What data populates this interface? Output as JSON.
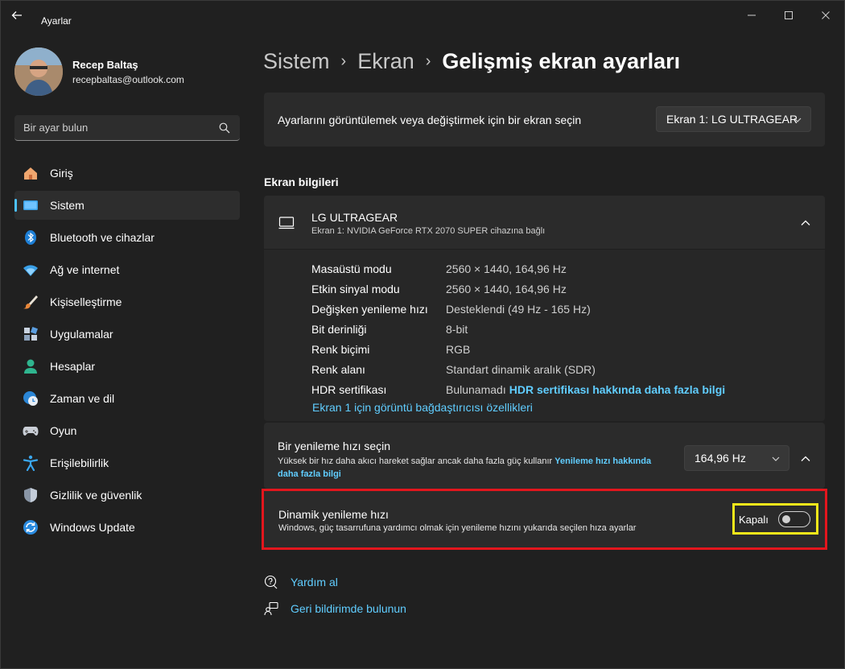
{
  "app": {
    "title": "Ayarlar"
  },
  "profile": {
    "name": "Recep Baltaş",
    "email": "recepbaltas@outlook.com"
  },
  "search": {
    "placeholder": "Bir ayar bulun"
  },
  "nav": {
    "items": [
      {
        "label": "Giriş",
        "icon": "home-icon"
      },
      {
        "label": "Sistem",
        "icon": "system-icon",
        "active": true
      },
      {
        "label": "Bluetooth ve cihazlar",
        "icon": "bluetooth-icon"
      },
      {
        "label": "Ağ ve internet",
        "icon": "wifi-icon"
      },
      {
        "label": "Kişiselleştirme",
        "icon": "brush-icon"
      },
      {
        "label": "Uygulamalar",
        "icon": "apps-icon"
      },
      {
        "label": "Hesaplar",
        "icon": "account-icon"
      },
      {
        "label": "Zaman ve dil",
        "icon": "clock-globe-icon"
      },
      {
        "label": "Oyun",
        "icon": "gamepad-icon"
      },
      {
        "label": "Erişilebilirlik",
        "icon": "accessibility-icon"
      },
      {
        "label": "Gizlilik ve güvenlik",
        "icon": "shield-icon"
      },
      {
        "label": "Windows Update",
        "icon": "update-icon"
      }
    ]
  },
  "breadcrumb": {
    "level1": "Sistem",
    "level2": "Ekran",
    "current": "Gelişmiş ekran ayarları",
    "separator": "›"
  },
  "display_select": {
    "label": "Ayarlarını görüntülemek veya değiştirmek için bir ekran seçin",
    "selected": "Ekran 1: LG ULTRAGEAR"
  },
  "info": {
    "section_title": "Ekran bilgileri",
    "monitor_name": "LG ULTRAGEAR",
    "monitor_sub": "Ekran 1: NVIDIA GeForce RTX 2070 SUPER cihazına bağlı",
    "rows": [
      {
        "key": "Masaüstü modu",
        "value": "2560 × 1440, 164,96 Hz"
      },
      {
        "key": "Etkin sinyal modu",
        "value": "2560 × 1440, 164,96 Hz"
      },
      {
        "key": "Değişken yenileme hızı",
        "value": "Desteklendi (49 Hz - 165 Hz)"
      },
      {
        "key": "Bit derinliği",
        "value": "8-bit"
      },
      {
        "key": "Renk biçimi",
        "value": "RGB"
      },
      {
        "key": "Renk alanı",
        "value": "Standart dinamik aralık (SDR)"
      },
      {
        "key": "HDR sertifikası",
        "value": "Bulunamadı",
        "link": "HDR sertifikası hakkında daha fazla bilgi"
      }
    ],
    "adapter_link": "Ekran 1 için görüntü bağdaştırıcısı özellikleri"
  },
  "refresh": {
    "title": "Bir yenileme hızı seçin",
    "desc": "Yüksek bir hız daha akıcı hareket sağlar ancak daha fazla güç kullanır",
    "link": "Yenileme hızı hakkında daha fazla bilgi",
    "selected": "164,96 Hz"
  },
  "dynamic": {
    "title": "Dinamik yenileme hızı",
    "desc": "Windows, güç tasarrufuna yardımcı olmak için yenileme hızını yukarıda seçilen hıza ayarlar",
    "toggle_label": "Kapalı",
    "toggle_on": false
  },
  "help": {
    "get_help": "Yardım al",
    "feedback": "Geri bildirimde bulunun"
  },
  "colors": {
    "accent": "#60cdff",
    "highlight_red": "#e3161d",
    "highlight_yellow": "#f5e71a"
  }
}
